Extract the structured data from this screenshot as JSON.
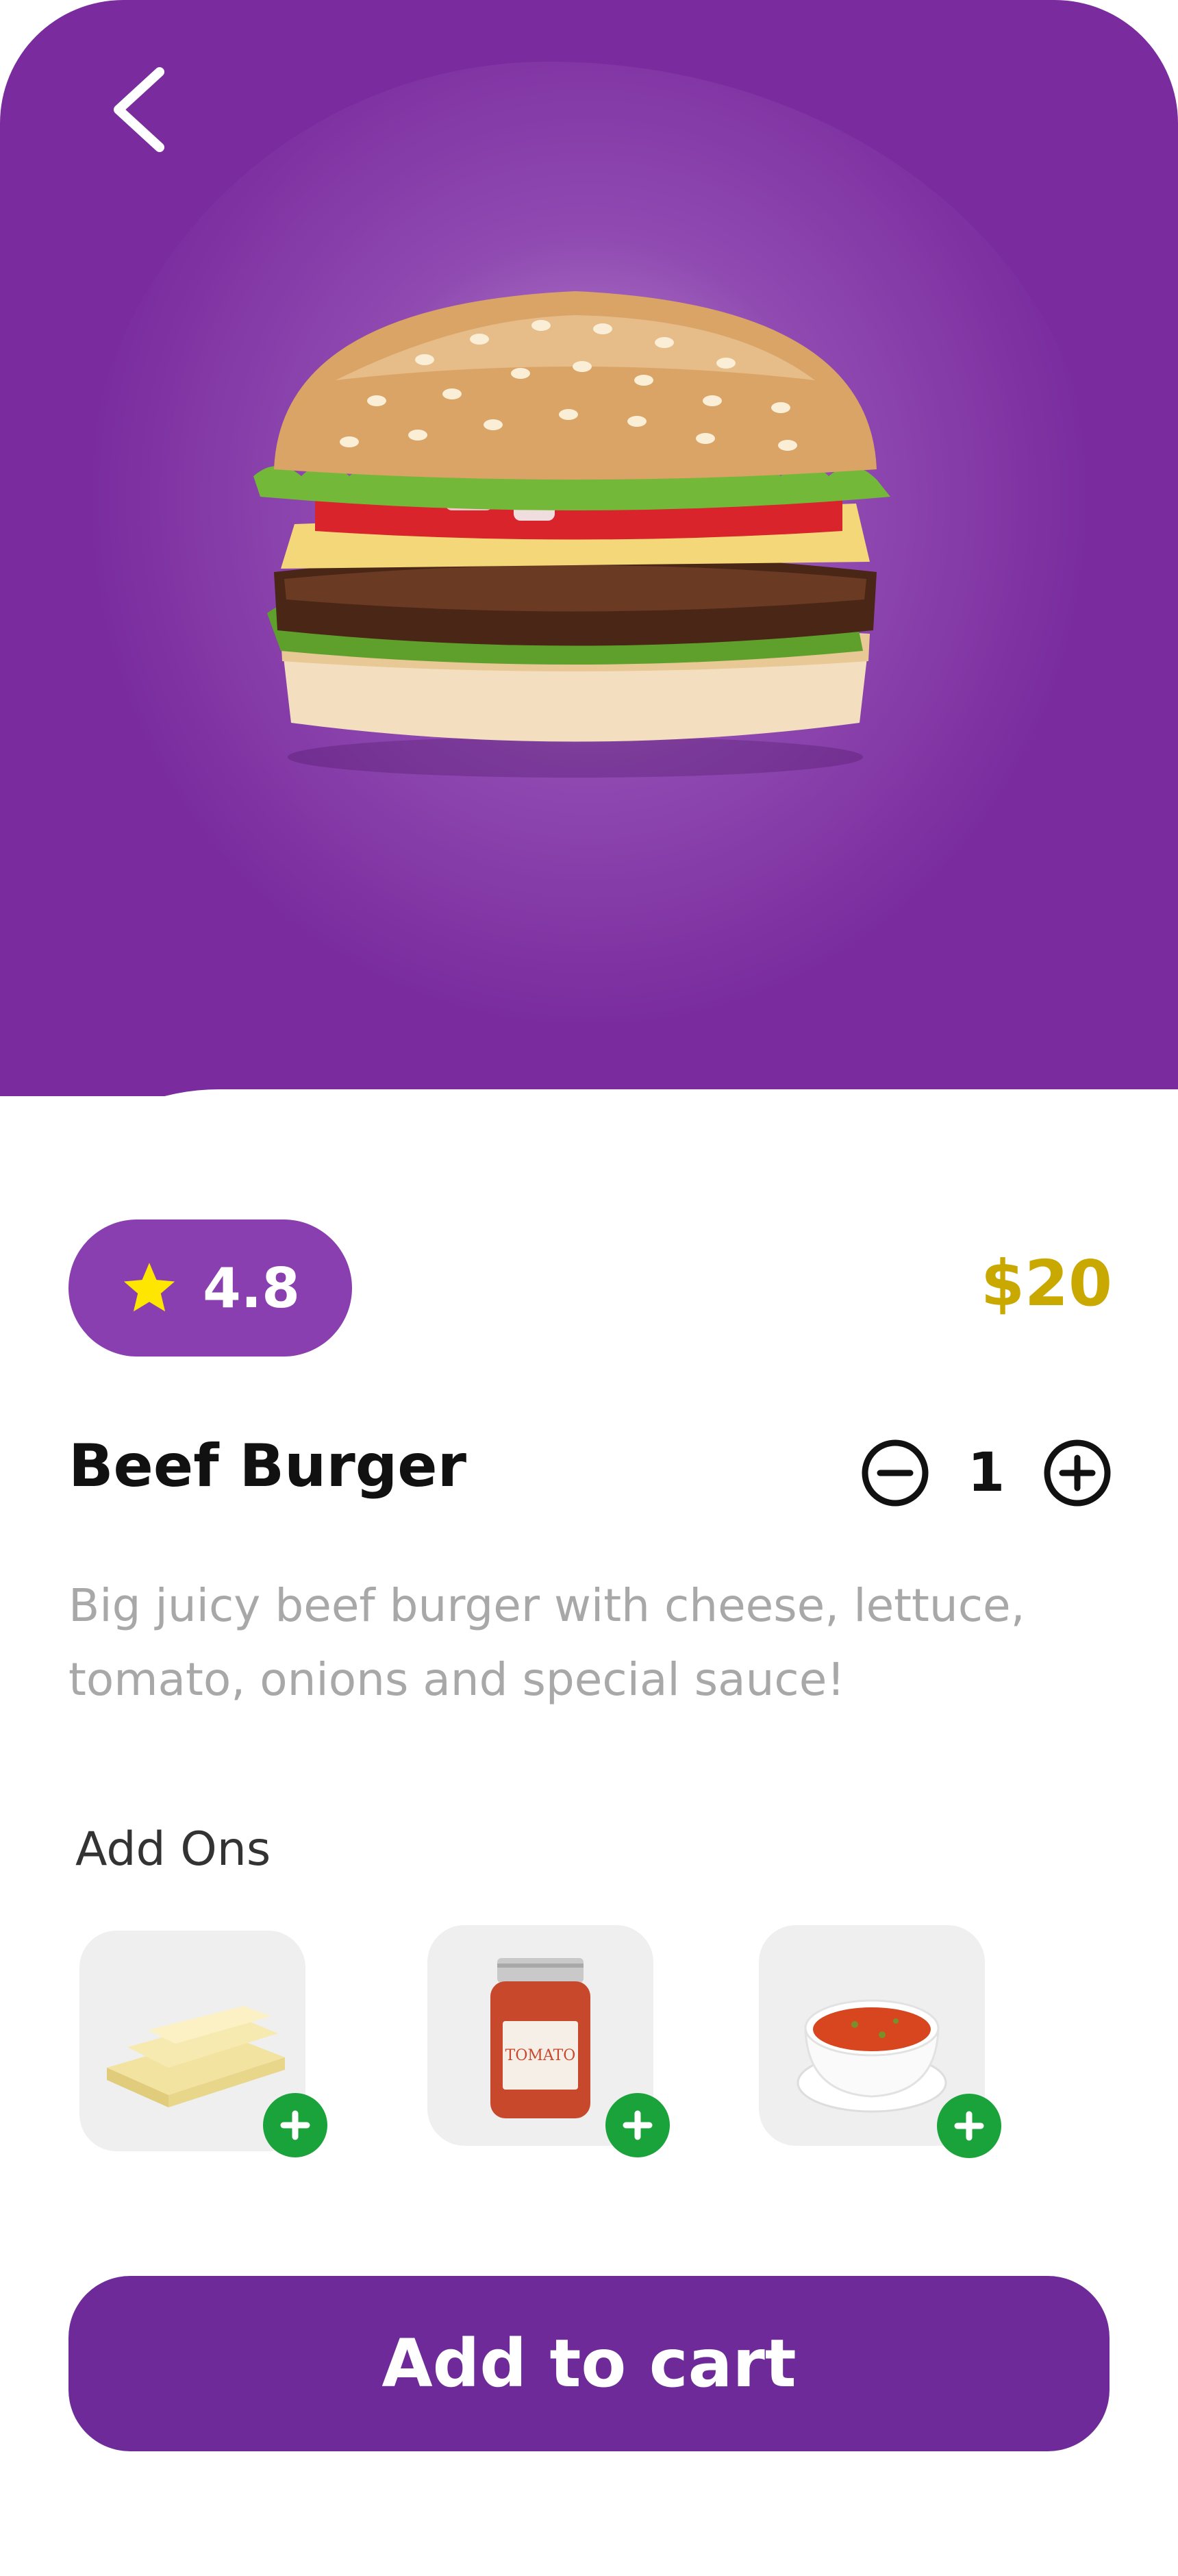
{
  "product": {
    "name": "Beef Burger",
    "rating": "4.8",
    "price": "$20",
    "description": "Big juicy beef burger with cheese, lettuce, tomato, onions and special sauce!"
  },
  "quantity": {
    "value": "1"
  },
  "addons": {
    "title": "Add Ons",
    "items": [
      {
        "icon": "cheese-slices"
      },
      {
        "icon": "tomato-sauce-jar",
        "jar_label": "TOMATO"
      },
      {
        "icon": "soup-bowl"
      }
    ]
  },
  "cart": {
    "label": "Add to cart"
  },
  "colors": {
    "primary": "#7a2c9e",
    "rating_pill": "#8a3fb0",
    "price": "#c9a800",
    "add": "#1aa33a",
    "star": "#ffe600"
  }
}
